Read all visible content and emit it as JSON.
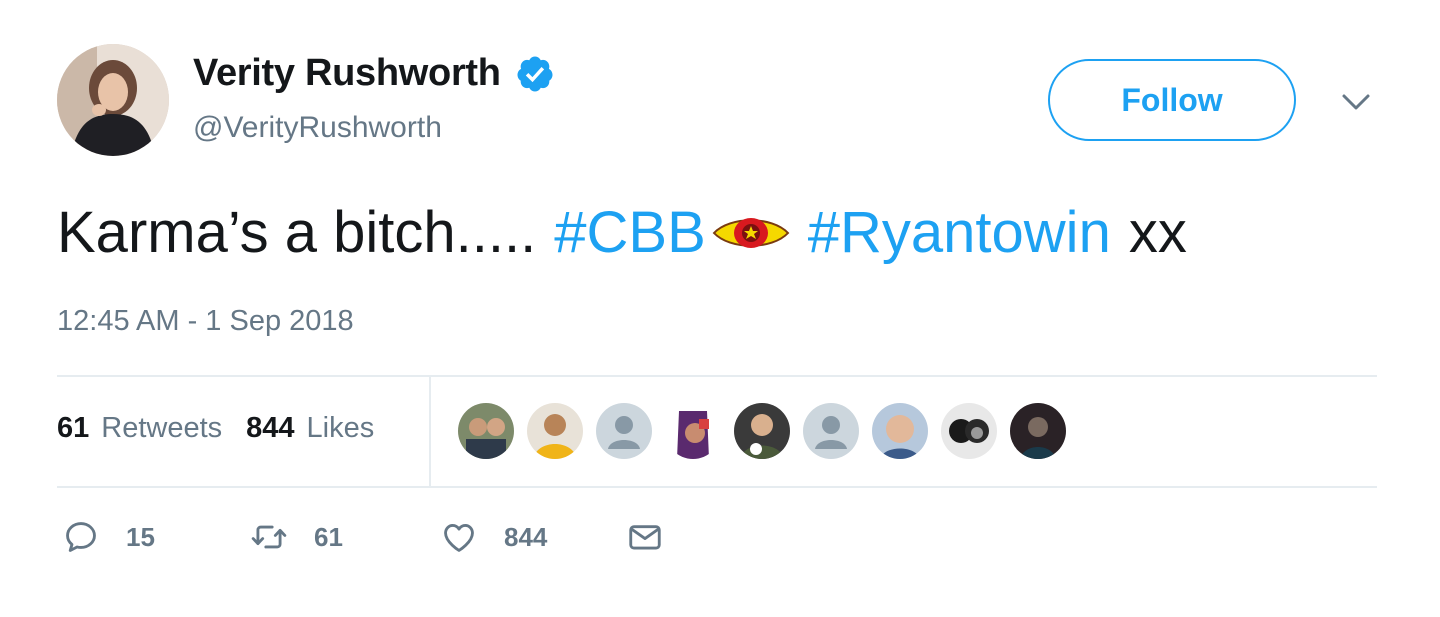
{
  "user": {
    "display_name": "Verity Rushworth",
    "handle": "@VerityRushworth",
    "verified": true,
    "avatar_icon": "profile-photo"
  },
  "follow_button": {
    "label": "Follow"
  },
  "menu": {
    "icon": "chevron-down-icon"
  },
  "tweet": {
    "text_start": "Karma’s a bitch.....",
    "hashtag_1": "#CBB",
    "emoji": "cbb-eye-icon",
    "hashtag_2": "#Ryantowin",
    "text_end": "xx",
    "timestamp": "12:45 AM - 1 Sep 2018"
  },
  "stats": {
    "retweets_count": "61",
    "retweets_label": "Retweets",
    "likes_count": "844",
    "likes_label": "Likes"
  },
  "likers_count_shown": 9,
  "actions": {
    "reply_count": "15",
    "retweet_count": "61",
    "like_count": "844"
  },
  "colors": {
    "accent": "#1da1f2",
    "text_primary": "#14171a",
    "text_secondary": "#657786",
    "divider": "#e6ecf0"
  }
}
